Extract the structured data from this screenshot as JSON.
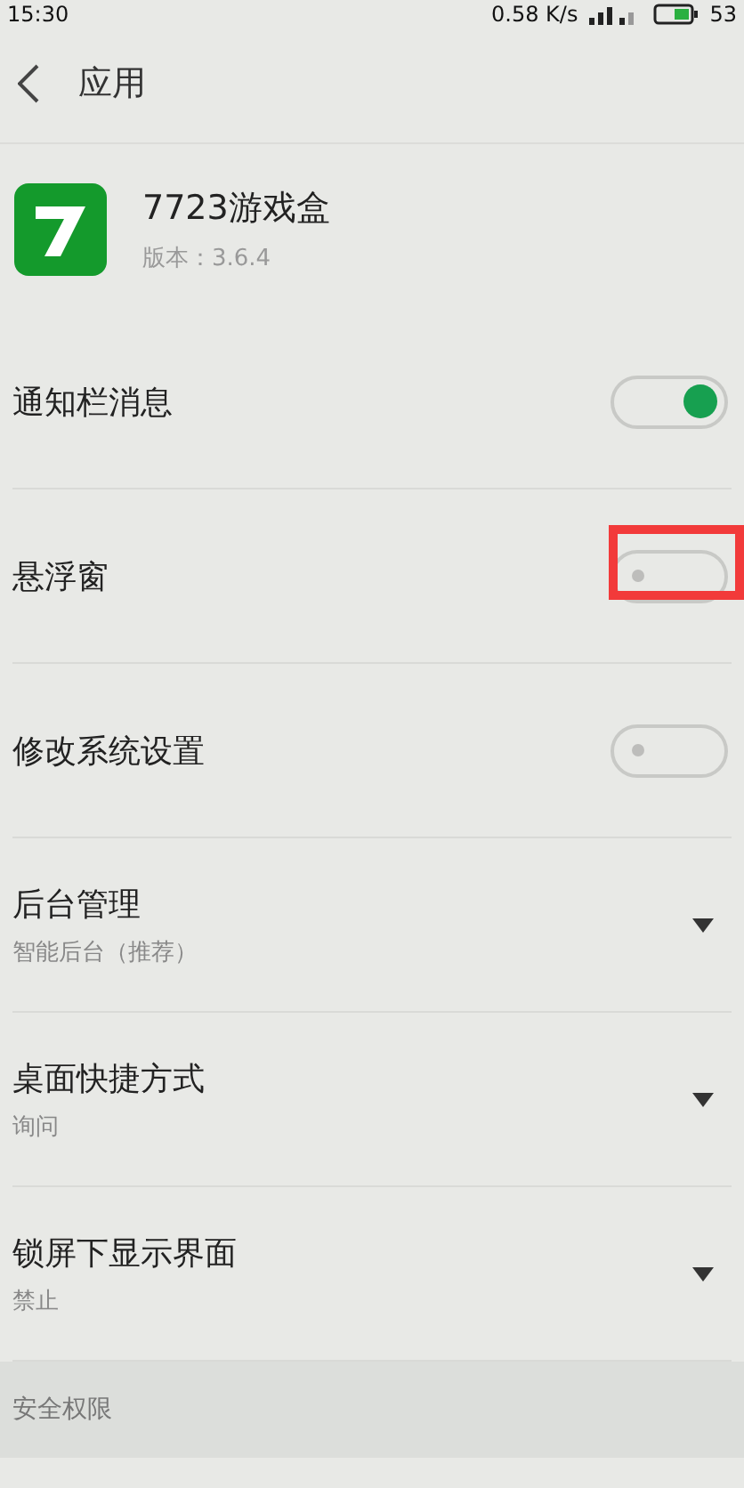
{
  "status_bar": {
    "time": "15:30",
    "speed": "0.58",
    "speed_unit": "K/s",
    "battery": "53"
  },
  "header": {
    "title": "应用"
  },
  "app": {
    "name": "7723游戏盒",
    "version": "版本：3.6.4"
  },
  "settings": [
    {
      "kind": "toggle",
      "label": "通知栏消息",
      "on": true,
      "highlighted": false
    },
    {
      "kind": "toggle",
      "label": "悬浮窗",
      "on": false,
      "highlighted": true
    },
    {
      "kind": "toggle",
      "label": "修改系统设置",
      "on": false,
      "highlighted": false
    },
    {
      "kind": "dropdown",
      "label": "后台管理",
      "value": "智能后台（推荐）"
    },
    {
      "kind": "dropdown",
      "label": "桌面快捷方式",
      "value": "询问"
    },
    {
      "kind": "dropdown",
      "label": "锁屏下显示界面",
      "value": "禁止"
    }
  ],
  "section": {
    "title": "安全权限"
  }
}
